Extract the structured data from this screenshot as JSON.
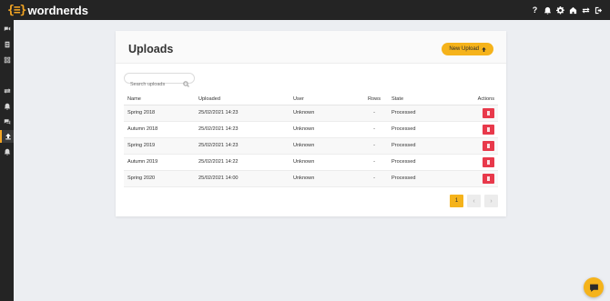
{
  "app": {
    "logo_mark": "{≡}",
    "logo_text": "wordnerds"
  },
  "topbar": {
    "icons": [
      "help-icon",
      "bell-icon",
      "gear-icon",
      "home-icon",
      "swap-icon",
      "logout-icon"
    ],
    "help_glyph": "?"
  },
  "sidebar": {
    "items": [
      "chat-voice-icon",
      "document-icon",
      "grid-icon",
      "swap-icon",
      "bell-icon",
      "comments-icon",
      "upload-icon",
      "alert-icon"
    ],
    "active": "upload-icon"
  },
  "page": {
    "title": "Uploads",
    "new_upload_label": "New Upload",
    "search_placeholder": "Search uploads"
  },
  "table": {
    "headers": {
      "name": "Name",
      "uploaded": "Uploaded",
      "user": "User",
      "rows": "Rows",
      "state": "State",
      "actions": "Actions"
    },
    "rows": [
      {
        "name": "Spring 2018",
        "uploaded": "25/02/2021 14:23",
        "user": "Unknown",
        "rows": "-",
        "state": "Processed"
      },
      {
        "name": "Autumn 2018",
        "uploaded": "25/02/2021 14:23",
        "user": "Unknown",
        "rows": "-",
        "state": "Processed"
      },
      {
        "name": "Spring 2019",
        "uploaded": "25/02/2021 14:23",
        "user": "Unknown",
        "rows": "-",
        "state": "Processed"
      },
      {
        "name": "Autumn 2019",
        "uploaded": "25/02/2021 14:22",
        "user": "Unknown",
        "rows": "-",
        "state": "Processed"
      },
      {
        "name": "Spring 2020",
        "uploaded": "25/02/2021 14:00",
        "user": "Unknown",
        "rows": "-",
        "state": "Processed"
      }
    ]
  },
  "pagination": {
    "current": "1",
    "prev": "‹",
    "next": "›"
  },
  "colors": {
    "accent": "#f5b31b",
    "danger": "#e8394b",
    "topbar": "#242424",
    "background": "#eceef2"
  }
}
